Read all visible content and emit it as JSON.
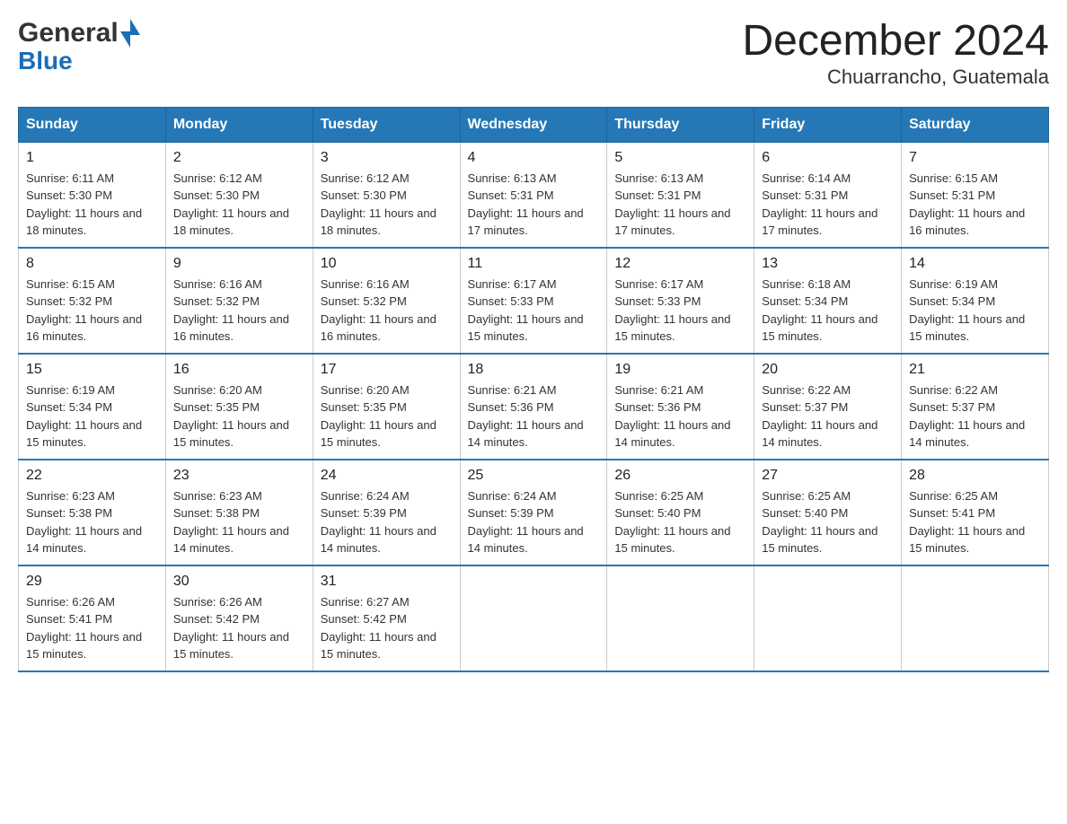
{
  "header": {
    "logo_general": "General",
    "logo_blue": "Blue",
    "month_title": "December 2024",
    "subtitle": "Chuarrancho, Guatemala"
  },
  "days_of_week": [
    "Sunday",
    "Monday",
    "Tuesday",
    "Wednesday",
    "Thursday",
    "Friday",
    "Saturday"
  ],
  "weeks": [
    [
      {
        "day": "1",
        "sunrise": "6:11 AM",
        "sunset": "5:30 PM",
        "daylight": "11 hours and 18 minutes."
      },
      {
        "day": "2",
        "sunrise": "6:12 AM",
        "sunset": "5:30 PM",
        "daylight": "11 hours and 18 minutes."
      },
      {
        "day": "3",
        "sunrise": "6:12 AM",
        "sunset": "5:30 PM",
        "daylight": "11 hours and 18 minutes."
      },
      {
        "day": "4",
        "sunrise": "6:13 AM",
        "sunset": "5:31 PM",
        "daylight": "11 hours and 17 minutes."
      },
      {
        "day": "5",
        "sunrise": "6:13 AM",
        "sunset": "5:31 PM",
        "daylight": "11 hours and 17 minutes."
      },
      {
        "day": "6",
        "sunrise": "6:14 AM",
        "sunset": "5:31 PM",
        "daylight": "11 hours and 17 minutes."
      },
      {
        "day": "7",
        "sunrise": "6:15 AM",
        "sunset": "5:31 PM",
        "daylight": "11 hours and 16 minutes."
      }
    ],
    [
      {
        "day": "8",
        "sunrise": "6:15 AM",
        "sunset": "5:32 PM",
        "daylight": "11 hours and 16 minutes."
      },
      {
        "day": "9",
        "sunrise": "6:16 AM",
        "sunset": "5:32 PM",
        "daylight": "11 hours and 16 minutes."
      },
      {
        "day": "10",
        "sunrise": "6:16 AM",
        "sunset": "5:32 PM",
        "daylight": "11 hours and 16 minutes."
      },
      {
        "day": "11",
        "sunrise": "6:17 AM",
        "sunset": "5:33 PM",
        "daylight": "11 hours and 15 minutes."
      },
      {
        "day": "12",
        "sunrise": "6:17 AM",
        "sunset": "5:33 PM",
        "daylight": "11 hours and 15 minutes."
      },
      {
        "day": "13",
        "sunrise": "6:18 AM",
        "sunset": "5:34 PM",
        "daylight": "11 hours and 15 minutes."
      },
      {
        "day": "14",
        "sunrise": "6:19 AM",
        "sunset": "5:34 PM",
        "daylight": "11 hours and 15 minutes."
      }
    ],
    [
      {
        "day": "15",
        "sunrise": "6:19 AM",
        "sunset": "5:34 PM",
        "daylight": "11 hours and 15 minutes."
      },
      {
        "day": "16",
        "sunrise": "6:20 AM",
        "sunset": "5:35 PM",
        "daylight": "11 hours and 15 minutes."
      },
      {
        "day": "17",
        "sunrise": "6:20 AM",
        "sunset": "5:35 PM",
        "daylight": "11 hours and 15 minutes."
      },
      {
        "day": "18",
        "sunrise": "6:21 AM",
        "sunset": "5:36 PM",
        "daylight": "11 hours and 14 minutes."
      },
      {
        "day": "19",
        "sunrise": "6:21 AM",
        "sunset": "5:36 PM",
        "daylight": "11 hours and 14 minutes."
      },
      {
        "day": "20",
        "sunrise": "6:22 AM",
        "sunset": "5:37 PM",
        "daylight": "11 hours and 14 minutes."
      },
      {
        "day": "21",
        "sunrise": "6:22 AM",
        "sunset": "5:37 PM",
        "daylight": "11 hours and 14 minutes."
      }
    ],
    [
      {
        "day": "22",
        "sunrise": "6:23 AM",
        "sunset": "5:38 PM",
        "daylight": "11 hours and 14 minutes."
      },
      {
        "day": "23",
        "sunrise": "6:23 AM",
        "sunset": "5:38 PM",
        "daylight": "11 hours and 14 minutes."
      },
      {
        "day": "24",
        "sunrise": "6:24 AM",
        "sunset": "5:39 PM",
        "daylight": "11 hours and 14 minutes."
      },
      {
        "day": "25",
        "sunrise": "6:24 AM",
        "sunset": "5:39 PM",
        "daylight": "11 hours and 14 minutes."
      },
      {
        "day": "26",
        "sunrise": "6:25 AM",
        "sunset": "5:40 PM",
        "daylight": "11 hours and 15 minutes."
      },
      {
        "day": "27",
        "sunrise": "6:25 AM",
        "sunset": "5:40 PM",
        "daylight": "11 hours and 15 minutes."
      },
      {
        "day": "28",
        "sunrise": "6:25 AM",
        "sunset": "5:41 PM",
        "daylight": "11 hours and 15 minutes."
      }
    ],
    [
      {
        "day": "29",
        "sunrise": "6:26 AM",
        "sunset": "5:41 PM",
        "daylight": "11 hours and 15 minutes."
      },
      {
        "day": "30",
        "sunrise": "6:26 AM",
        "sunset": "5:42 PM",
        "daylight": "11 hours and 15 minutes."
      },
      {
        "day": "31",
        "sunrise": "6:27 AM",
        "sunset": "5:42 PM",
        "daylight": "11 hours and 15 minutes."
      },
      null,
      null,
      null,
      null
    ]
  ],
  "labels": {
    "sunrise_prefix": "Sunrise: ",
    "sunset_prefix": "Sunset: ",
    "daylight_prefix": "Daylight: "
  }
}
